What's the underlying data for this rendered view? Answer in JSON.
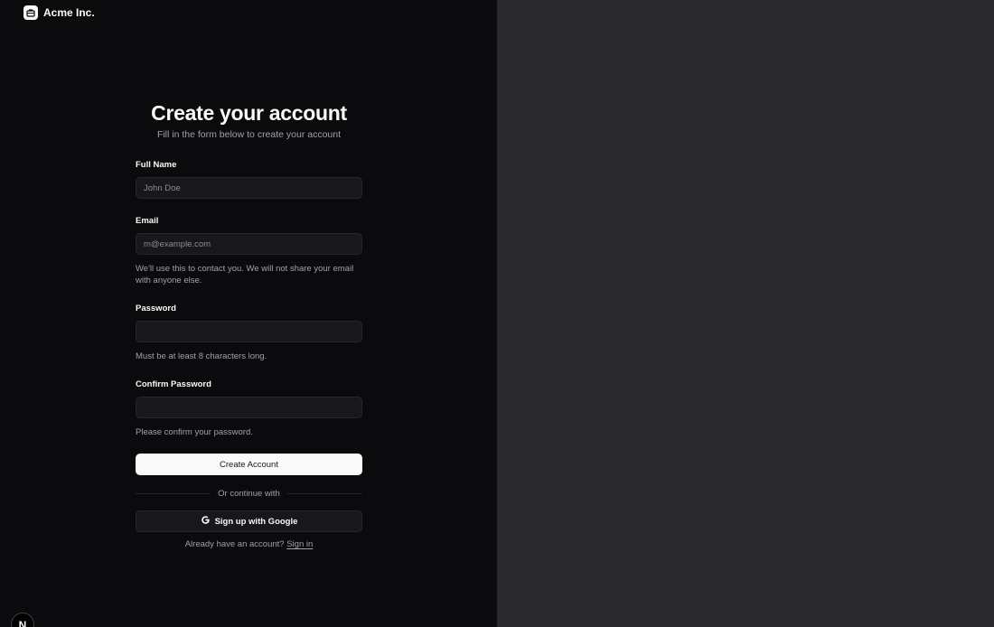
{
  "brand": {
    "name": "Acme Inc.",
    "logo_icon": "briefcase-icon"
  },
  "form": {
    "title": "Create your account",
    "subtitle": "Fill in the form below to create your account",
    "full_name": {
      "label": "Full Name",
      "placeholder": "John Doe",
      "value": ""
    },
    "email": {
      "label": "Email",
      "placeholder": "m@example.com",
      "value": "",
      "help": "We'll use this to contact you. We will not share your email with anyone else."
    },
    "password": {
      "label": "Password",
      "value": "",
      "help": "Must be at least 8 characters long."
    },
    "confirm_password": {
      "label": "Confirm Password",
      "value": "",
      "help": "Please confirm your password."
    },
    "submit_label": "Create Account",
    "divider_text": "Or continue with",
    "google_label": "Sign up with Google",
    "signin_prompt": "Already have an account?",
    "signin_link": "Sign in"
  },
  "dev_badge": {
    "letter": "N"
  },
  "colors": {
    "left_background": "#0b0a0d",
    "right_background": "#29282b",
    "primary_button": "#fafafa",
    "input_background": "#18171b",
    "input_border": "#27272a"
  }
}
